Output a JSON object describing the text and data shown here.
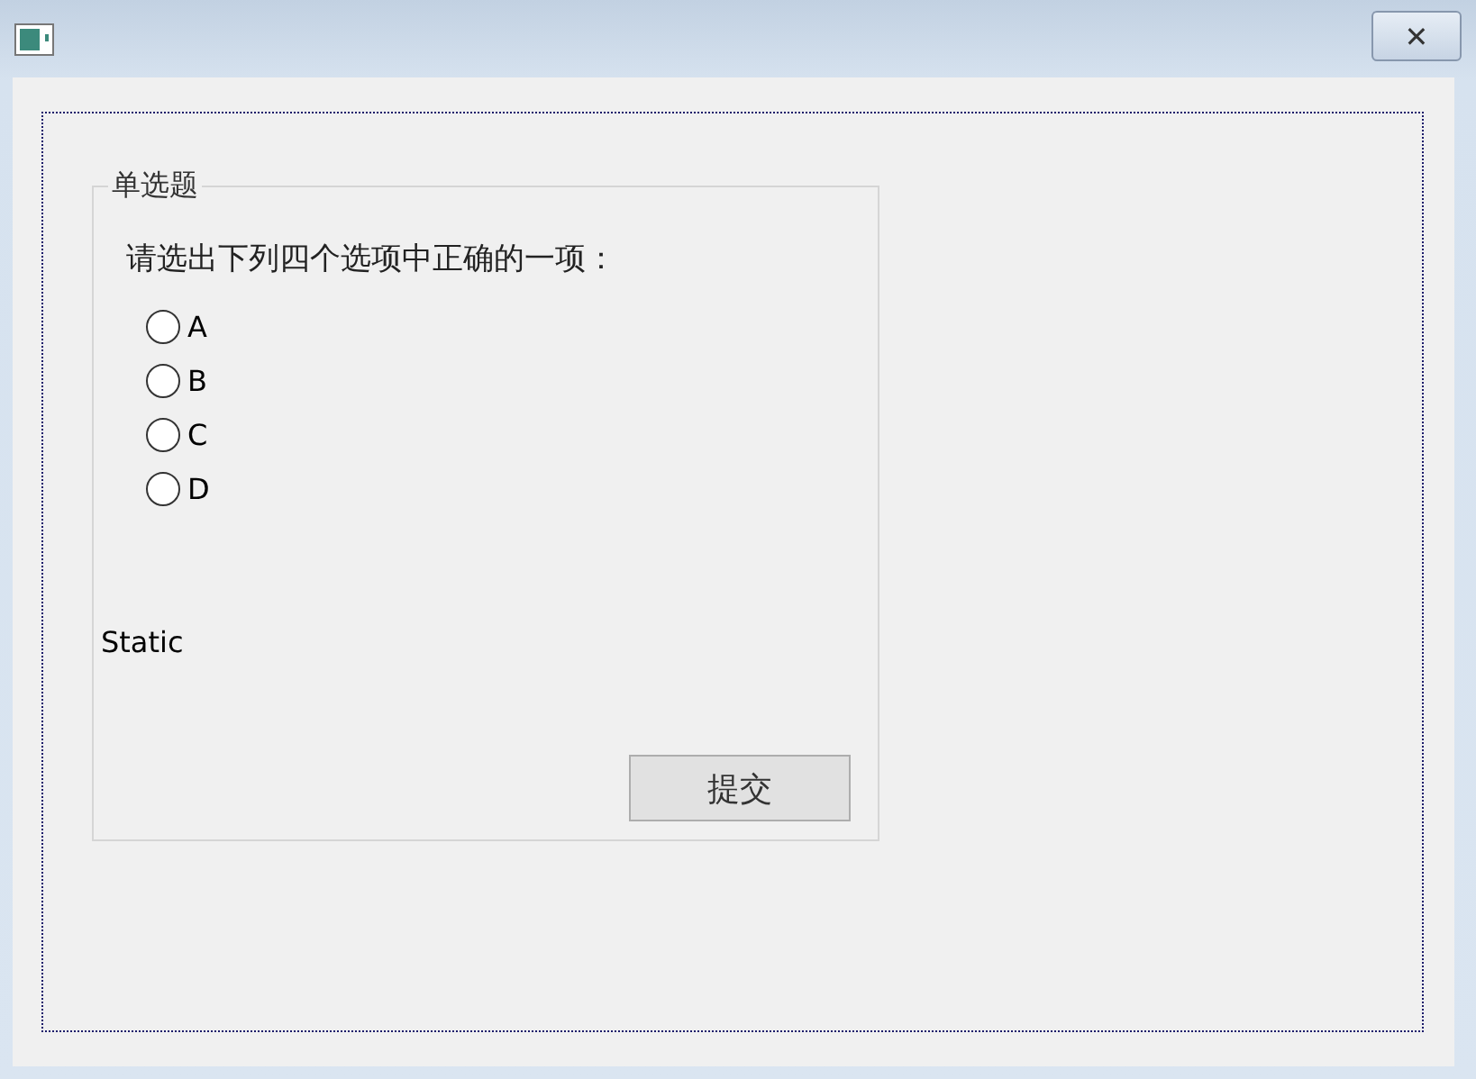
{
  "window": {
    "close_label": "✕"
  },
  "group": {
    "title": "单选题",
    "question": "请选出下列四个选项中正确的一项：",
    "options": [
      {
        "label": "A",
        "selected": false
      },
      {
        "label": "B",
        "selected": false
      },
      {
        "label": "C",
        "selected": false
      },
      {
        "label": "D",
        "selected": false
      }
    ],
    "static_text": "Static",
    "submit": "提交"
  }
}
